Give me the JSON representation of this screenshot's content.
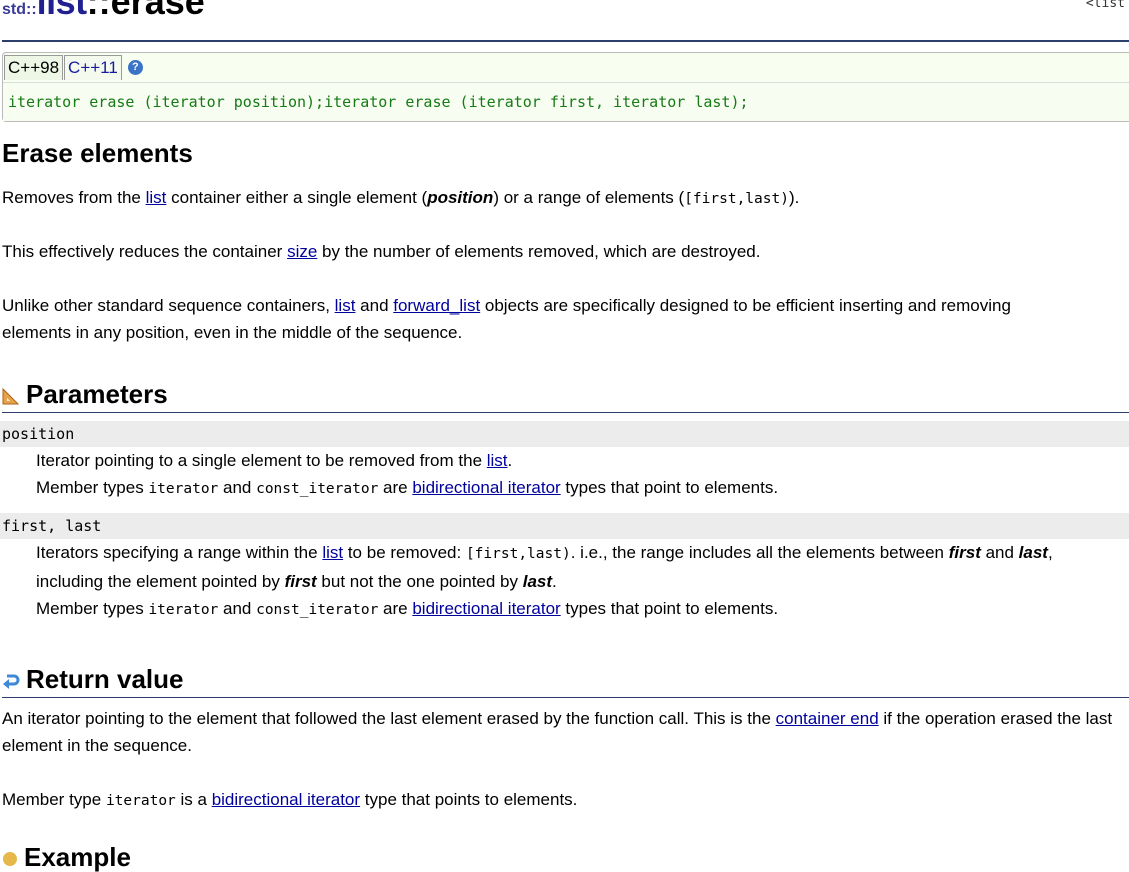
{
  "header": {
    "namespace": "std::",
    "title_list": "list",
    "title_sep": "::",
    "title_fn": "erase",
    "top_right_fragment": "<list"
  },
  "declaration": {
    "tabs": [
      "C++98",
      "C++11"
    ],
    "help_icon": "question-icon",
    "code": "iterator erase (iterator position);iterator erase (iterator first, iterator last);"
  },
  "description": {
    "heading": "Erase elements",
    "p1": {
      "a": "Removes from the ",
      "link": "list",
      "b": " container either a single element (",
      "em": "position",
      "c": ") or a range of elements (",
      "code": "[first,last)",
      "d": ")."
    },
    "p2": {
      "a": "This effectively reduces the container ",
      "link": "size",
      "b": " by the number of elements removed, which are destroyed."
    },
    "p3": {
      "a": "Unlike other standard sequence containers, ",
      "link1": "list",
      "b": " and ",
      "link2": "forward_list",
      "c": " objects are specifically designed to be efficient inserting and removing elements in any position, even in the middle of the sequence."
    }
  },
  "parameters": {
    "heading": "Parameters",
    "icon": "ruler-icon",
    "items": [
      {
        "name": "position",
        "line1_a": "Iterator pointing to a single element to be removed from the ",
        "line1_link": "list",
        "line1_b": ".",
        "line2_a": "Member types ",
        "line2_code1": "iterator",
        "line2_b": " and ",
        "line2_code2": "const_iterator",
        "line2_c": " are ",
        "line2_link": "bidirectional iterator",
        "line2_d": " types that point to elements."
      },
      {
        "name": "first, last",
        "p_a": "Iterators specifying a range within the ",
        "p_link": "list",
        "p_b": " to be removed: ",
        "p_code": "[first,last)",
        "p_c": ". i.e., the range includes all the elements between ",
        "p_em1": "first",
        "p_d": " and ",
        "p_em2": "last",
        "p_e": ", including the element pointed by ",
        "p_em3": "first",
        "p_f": " but not the one pointed by ",
        "p_em4": "last",
        "p_g": ".",
        "line2_a": "Member types ",
        "line2_code1": "iterator",
        "line2_b": " and ",
        "line2_code2": "const_iterator",
        "line2_c": " are ",
        "line2_link": "bidirectional iterator",
        "line2_d": " types that point to elements."
      }
    ]
  },
  "return_value": {
    "heading": "Return value",
    "icon": "return-arrow-icon",
    "p1_a": "An iterator pointing to the element that followed the last element erased by the function call. This is the ",
    "p1_link": "container end",
    "p1_b": " if the operation erased the last element in the sequence.",
    "p2_a": "Member type ",
    "p2_code": "iterator",
    "p2_b": " is a ",
    "p2_link": "bidirectional iterator",
    "p2_c": " type that points to elements."
  },
  "example": {
    "heading": "Example",
    "icon": "example-icon"
  }
}
